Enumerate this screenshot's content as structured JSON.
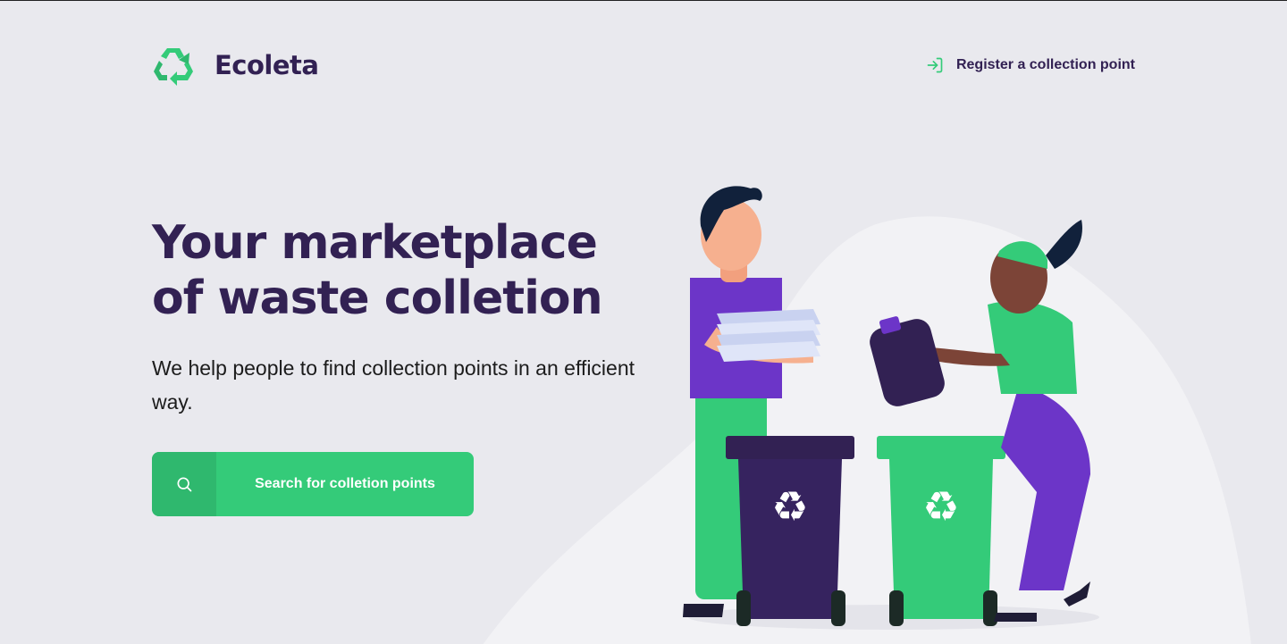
{
  "header": {
    "brand": "Ecoleta",
    "register_label": "Register a collection point"
  },
  "hero": {
    "title": "Your marketplace of waste colletion",
    "subtitle": "We help people to find collection points in an efficient way.",
    "search_label": "Search for colletion points"
  },
  "colors": {
    "primary": "#34cb79",
    "primary_dark": "#2fb86e",
    "title": "#322153",
    "background": "#e9e9ee"
  }
}
